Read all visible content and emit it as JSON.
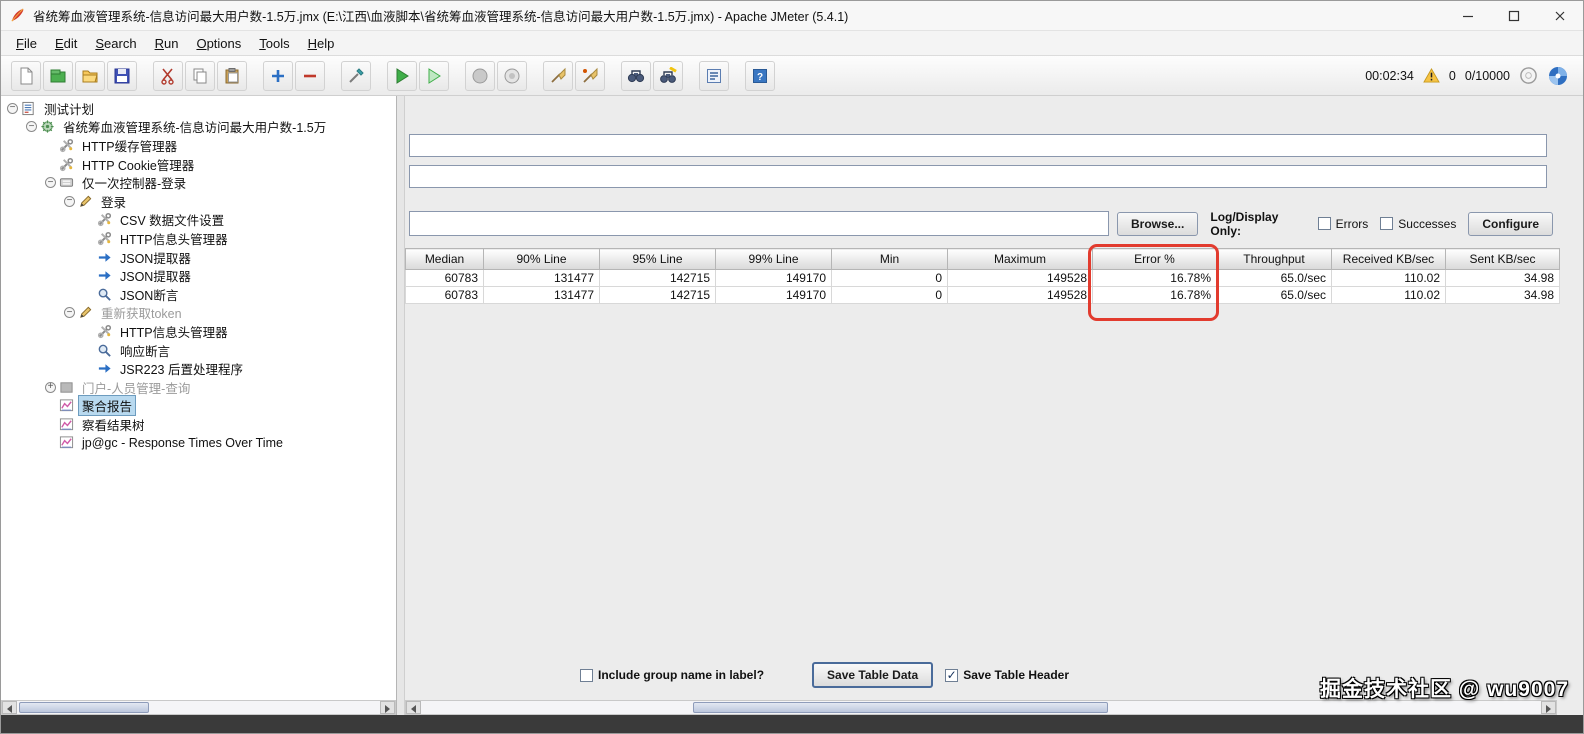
{
  "titlebar": {
    "title": "省统筹血液管理系统-信息访问最大用户数-1.5万.jmx (E:\\江西\\血液脚本\\省统筹血液管理系统-信息访问最大用户数-1.5万.jmx) - Apache JMeter (5.4.1)"
  },
  "menu": {
    "items": [
      "File",
      "Edit",
      "Search",
      "Run",
      "Options",
      "Tools",
      "Help"
    ]
  },
  "toolbar": {
    "buttons": [
      {
        "name": "new-file",
        "icon": "file",
        "gap": false
      },
      {
        "name": "templates",
        "icon": "templates",
        "gap": false
      },
      {
        "name": "open-file",
        "icon": "open",
        "gap": false
      },
      {
        "name": "save",
        "icon": "save",
        "gap": false
      },
      {
        "name": "cut",
        "icon": "cut",
        "gap": true
      },
      {
        "name": "copy",
        "icon": "copy",
        "gap": false
      },
      {
        "name": "paste",
        "icon": "paste",
        "gap": false
      },
      {
        "name": "add",
        "icon": "plus",
        "gap": true
      },
      {
        "name": "remove",
        "icon": "minus",
        "gap": false
      },
      {
        "name": "toggle",
        "icon": "toggle",
        "gap": true
      },
      {
        "name": "start",
        "icon": "start",
        "gap": true
      },
      {
        "name": "start-no-timers",
        "icon": "start-outline",
        "gap": false
      },
      {
        "name": "stop",
        "icon": "stop",
        "gap": true
      },
      {
        "name": "shutdown",
        "icon": "shutdown",
        "gap": false
      },
      {
        "name": "clear",
        "icon": "broom",
        "gap": true
      },
      {
        "name": "clear-all",
        "icon": "broom-all",
        "gap": false
      },
      {
        "name": "search",
        "icon": "binoculars",
        "gap": true
      },
      {
        "name": "search-reset",
        "icon": "binoculars-reset",
        "gap": false
      },
      {
        "name": "function-helper",
        "icon": "function",
        "gap": true
      },
      {
        "name": "help",
        "icon": "help",
        "gap": true
      }
    ],
    "status": {
      "elapsed": "00:02:34",
      "errors": "0",
      "threads": "0/10000"
    }
  },
  "tree": {
    "items": [
      {
        "label": "测试计划",
        "icon": "test-plan",
        "level": 0,
        "handle": "minus",
        "disabled": false,
        "selected": false
      },
      {
        "label": "省统筹血液管理系统-信息访问最大用户数-1.5万",
        "icon": "thread-group",
        "level": 1,
        "handle": "minus",
        "disabled": false,
        "selected": false
      },
      {
        "label": "HTTP缓存管理器",
        "icon": "wrench",
        "level": 2,
        "handle": "none",
        "disabled": false,
        "selected": false
      },
      {
        "label": "HTTP Cookie管理器",
        "icon": "wrench",
        "level": 2,
        "handle": "none",
        "disabled": false,
        "selected": false
      },
      {
        "label": "仅一次控制器-登录",
        "icon": "controller",
        "level": 2,
        "handle": "minus",
        "disabled": false,
        "selected": false
      },
      {
        "label": "登录",
        "icon": "pencil",
        "level": 3,
        "handle": "minus",
        "disabled": false,
        "selected": false
      },
      {
        "label": "CSV 数据文件设置",
        "icon": "wrench",
        "level": 4,
        "handle": "none",
        "disabled": false,
        "selected": false
      },
      {
        "label": "HTTP信息头管理器",
        "icon": "wrench",
        "level": 4,
        "handle": "none",
        "disabled": false,
        "selected": false
      },
      {
        "label": "JSON提取器",
        "icon": "arrow",
        "level": 4,
        "handle": "none",
        "disabled": false,
        "selected": false
      },
      {
        "label": "JSON提取器",
        "icon": "arrow",
        "level": 4,
        "handle": "none",
        "disabled": false,
        "selected": false
      },
      {
        "label": "JSON断言",
        "icon": "magnifier",
        "level": 4,
        "handle": "none",
        "disabled": false,
        "selected": false
      },
      {
        "label": "重新获取token",
        "icon": "pencil",
        "level": 3,
        "handle": "minus",
        "disabled": true,
        "selected": false
      },
      {
        "label": "HTTP信息头管理器",
        "icon": "wrench",
        "level": 4,
        "handle": "none",
        "disabled": false,
        "selected": false
      },
      {
        "label": "响应断言",
        "icon": "magnifier",
        "level": 4,
        "handle": "none",
        "disabled": false,
        "selected": false
      },
      {
        "label": "JSR223 后置处理程序",
        "icon": "arrow",
        "level": 4,
        "handle": "none",
        "disabled": false,
        "selected": false
      },
      {
        "label": "门户-人员管理-查询",
        "icon": "box",
        "level": 2,
        "handle": "plus",
        "disabled": true,
        "selected": false
      },
      {
        "label": "聚合报告",
        "icon": "chart",
        "level": 2,
        "handle": "none",
        "disabled": false,
        "selected": true
      },
      {
        "label": "察看结果树",
        "icon": "chart",
        "level": 2,
        "handle": "none",
        "disabled": false,
        "selected": false
      },
      {
        "label": "jp@gc - Response Times Over Time",
        "icon": "chart",
        "level": 2,
        "handle": "none",
        "disabled": false,
        "selected": false
      }
    ]
  },
  "panel": {
    "name_value": "",
    "comments_value": "",
    "filename_value": "",
    "browse": "Browse...",
    "log_display": "Log/Display Only:",
    "errors": "Errors",
    "successes": "Successes",
    "configure": "Configure",
    "errors_checked": false,
    "successes_checked": false,
    "include_group": "Include group name in label?",
    "include_group_checked": false,
    "save_table": "Save Table Data",
    "save_header": "Save Table Header",
    "save_header_checked": true
  },
  "table": {
    "columns": [
      "Median",
      "90% Line",
      "95% Line",
      "99% Line",
      "Min",
      "Maximum",
      "Error %",
      "Throughput",
      "Received KB/sec",
      "Sent KB/sec"
    ],
    "rows": [
      [
        "60783",
        "131477",
        "142715",
        "149170",
        "0",
        "149528",
        "16.78%",
        "65.0/sec",
        "110.02",
        "34.98"
      ],
      [
        "60783",
        "131477",
        "142715",
        "149170",
        "0",
        "149528",
        "16.78%",
        "65.0/sec",
        "110.02",
        "34.98"
      ]
    ]
  },
  "annotation": {
    "type": "highlight-box",
    "column": "Error %",
    "color": "#e23b2e"
  },
  "watermark": "掘金技术社区 @ wu9007"
}
